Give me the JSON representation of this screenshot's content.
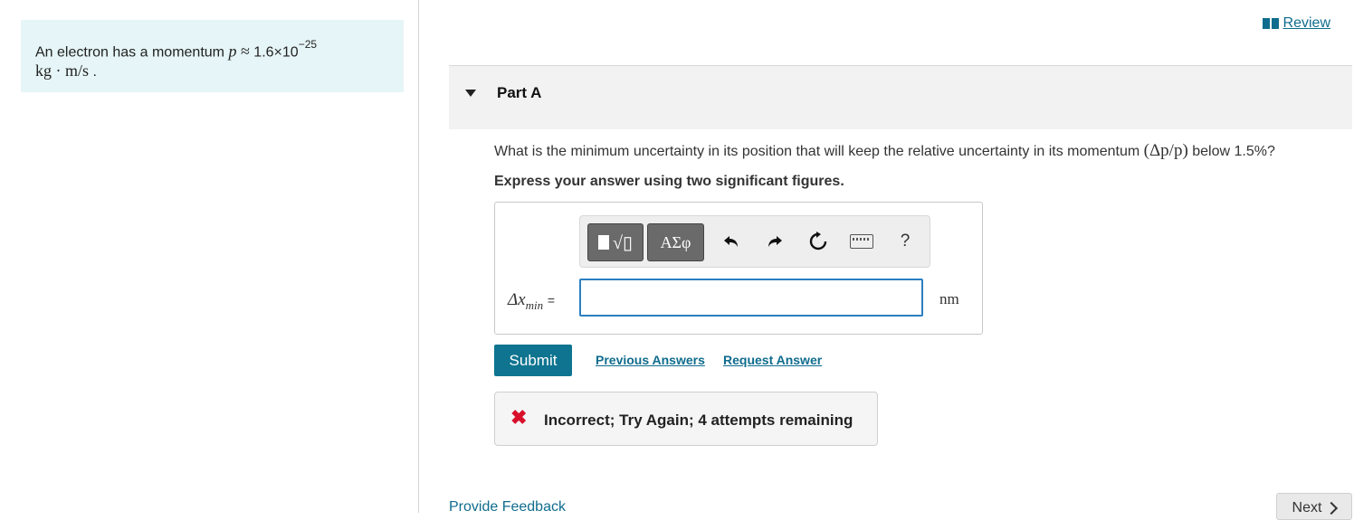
{
  "problem": {
    "intro": "An electron has a momentum",
    "symbol": "p",
    "approx": "≈",
    "value": "1.6×10",
    "exponent": "−25",
    "units": "kg · m/s",
    "end": "."
  },
  "header": {
    "review_label": "Review"
  },
  "part": {
    "title": "Part A"
  },
  "question": {
    "text": "What is the minimum uncertainty in its position that will keep the relative uncertainty in its momentum",
    "math": "(Δp/p)",
    "text_end": "below 1.5%?",
    "instruction": "Express your answer using two significant figures."
  },
  "toolbar": {
    "symbols_label": "ΑΣφ",
    "undo_icon": "undo-icon",
    "redo_icon": "redo-icon",
    "reset_icon": "reset-icon",
    "keyboard_icon": "keyboard-icon",
    "help_label": "?"
  },
  "answer": {
    "variable": "Δx",
    "subscript": "min",
    "equals": "=",
    "value": "",
    "unit": "nm"
  },
  "actions": {
    "submit_label": "Submit",
    "previous_answers_label": "Previous Answers",
    "request_answer_label": "Request Answer"
  },
  "feedback": {
    "icon": "x-icon",
    "message": "Incorrect; Try Again; 4 attempts remaining",
    "color": "#d8102b"
  },
  "footer": {
    "provide_feedback_label": "Provide Feedback",
    "next_label": "Next"
  }
}
